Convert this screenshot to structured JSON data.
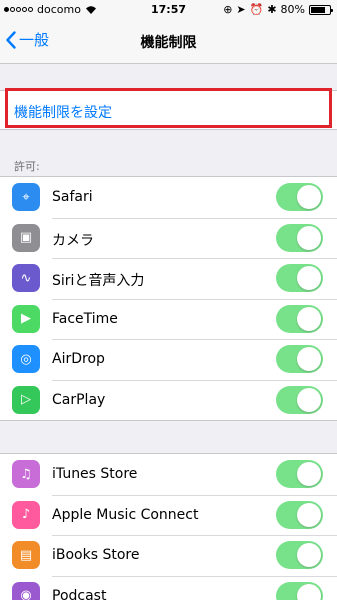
{
  "status_bar": {
    "carrier": "docomo",
    "time": "17:57",
    "battery_percent": "80%",
    "battery_level": 0.8
  },
  "nav": {
    "back_label": "一般",
    "title": "機能制限"
  },
  "enable_restrictions": {
    "label": "機能制限を設定",
    "highlight_color": "#e0242c"
  },
  "allow_section": {
    "header": "許可:",
    "items": [
      {
        "label": "Safari",
        "icon": "compass-icon",
        "color": "#2d8cf0",
        "on": true
      },
      {
        "label": "カメラ",
        "icon": "camera-icon",
        "color": "#8e8e93",
        "on": true
      },
      {
        "label": "Siriと音声入力",
        "icon": "siri-icon",
        "color": "#6a5acd",
        "on": true
      },
      {
        "label": "FaceTime",
        "icon": "video-icon",
        "color": "#4cd964",
        "on": true
      },
      {
        "label": "AirDrop",
        "icon": "airdrop-icon",
        "color": "#1e90ff",
        "on": true
      },
      {
        "label": "CarPlay",
        "icon": "play-icon",
        "color": "#34c759",
        "on": true
      }
    ]
  },
  "store_section": {
    "items": [
      {
        "label": "iTunes Store",
        "icon": "music-note-icon",
        "color": "#c86dd7",
        "on": true
      },
      {
        "label": "Apple Music Connect",
        "icon": "music-icon",
        "color": "#ff5a9e",
        "on": true
      },
      {
        "label": "iBooks Store",
        "icon": "book-icon",
        "color": "#f28c28",
        "on": true
      },
      {
        "label": "Podcast",
        "icon": "podcast-icon",
        "color": "#9b59d0",
        "on": true
      }
    ]
  },
  "colors": {
    "accent": "#007aff",
    "toggle_on": "#4cd964"
  }
}
